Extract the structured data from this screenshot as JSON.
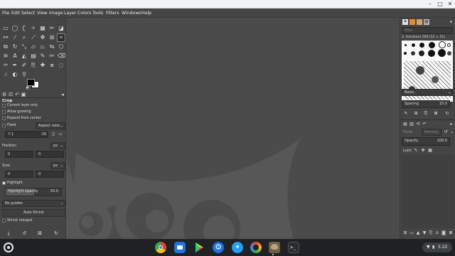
{
  "menubar": {
    "items": [
      "File",
      "Edit",
      "Select",
      "View",
      "Image",
      "Layer",
      "Colors",
      "Tools",
      "Filters",
      "Windows",
      "Help"
    ]
  },
  "window_controls": {
    "minimize": "–",
    "maximize": "□",
    "close": "✕"
  },
  "tool_options": {
    "title": "Crop",
    "current_layer_only": "Current layer only",
    "allow_growing": "Allow growing",
    "expand_from_center": "Expand from center",
    "fixed_label": "Fixed",
    "fixed_value": "Aspect ratio",
    "ratio_value": "7:1",
    "position_label": "Position:",
    "position_unit": "px",
    "position_x": "0",
    "position_y": "0",
    "size_label": "Size:",
    "size_unit": "px",
    "size_w": "0",
    "size_h": "0",
    "highlight_label": "Highlight",
    "highlight_opacity_label": "Highlight opacity",
    "highlight_opacity_value": "50.0",
    "guides_value": "No guides",
    "auto_shrink_label": "Auto Shrink",
    "shrink_merged_label": "Shrink merged"
  },
  "brushes": {
    "filter_placeholder": "filter",
    "selected_brush": "2. Hardness 050 (51 × 51)",
    "brush_set": "Basic,",
    "spacing_label": "Spacing",
    "spacing_value": "10.0"
  },
  "layers": {
    "mode_label": "Mode",
    "mode_value": "Normal",
    "opacity_label": "Opacity",
    "opacity_value": "100.0",
    "lock_label": "Lock:"
  },
  "shelf": {
    "time": "5:22",
    "apps": [
      "chrome",
      "files",
      "play-store",
      "settings",
      "twitter",
      "camera",
      "gimp",
      "terminal"
    ]
  },
  "colors": {
    "canvas_bg": "#4b4b4b",
    "wilber": "#575757",
    "panel_bg": "#454545",
    "fg_color": "#000000",
    "bg_color": "#ffffff"
  }
}
